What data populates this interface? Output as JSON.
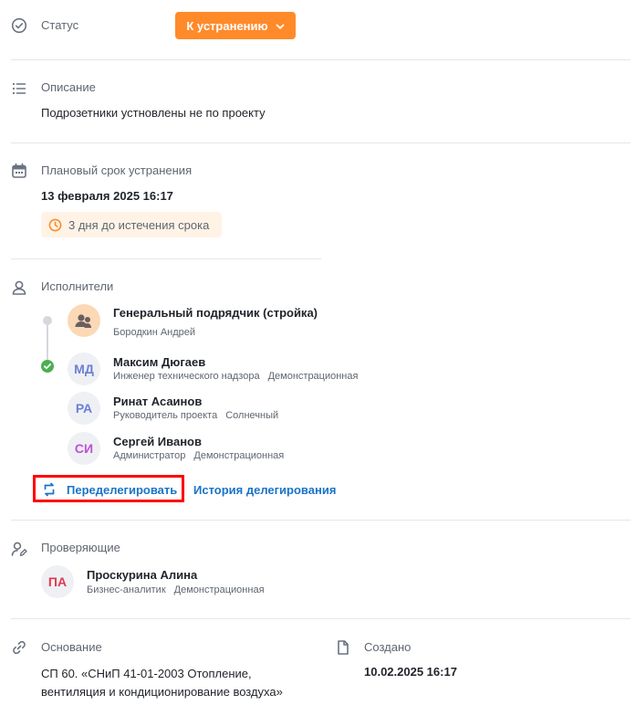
{
  "status": {
    "label": "Статус",
    "value": "К устранению"
  },
  "description": {
    "label": "Описание",
    "text": "Подрозетники устновлены не по проекту"
  },
  "due": {
    "label": "Плановый срок устранения",
    "date": "13 февраля 2025 16:17",
    "remaining": "3 дня до истечения срока"
  },
  "executors": {
    "label": "Исполнители",
    "group": {
      "name": "Генеральный подрядчик (стройка)",
      "person": "Бородкин Андрей"
    },
    "people": [
      {
        "initials": "МД",
        "name": "Максим Дюгаев",
        "role": "Инженер технического надзора",
        "company": "Демонстрационная",
        "color": "#6b7fd6"
      },
      {
        "initials": "РА",
        "name": "Ринат Асаинов",
        "role": "Руководитель проекта",
        "company": "Солнечный",
        "color": "#6b7fd6"
      },
      {
        "initials": "СИ",
        "name": "Сергей Иванов",
        "role": "Администратор",
        "company": "Демонстрационная",
        "color": "#c04fd8"
      }
    ],
    "redelegate": "Переделегировать",
    "history": "История делегирования"
  },
  "reviewers": {
    "label": "Проверяющие",
    "person": {
      "initials": "ПА",
      "name": "Проскурина Алина",
      "role": "Бизнес-аналитик",
      "company": "Демонстрационная",
      "color": "#e23a4e"
    }
  },
  "basis": {
    "label": "Основание",
    "text": "СП 60. «СНиП 41-01-2003 Отопление, вентиляция и кондиционирование воздуха»"
  },
  "created": {
    "label": "Создано",
    "value": "10.02.2025 16:17"
  },
  "colors": {
    "accent": "#ff8a2a",
    "link": "#1a73c8",
    "success": "#4caf50",
    "highlight": "#ff0000"
  }
}
